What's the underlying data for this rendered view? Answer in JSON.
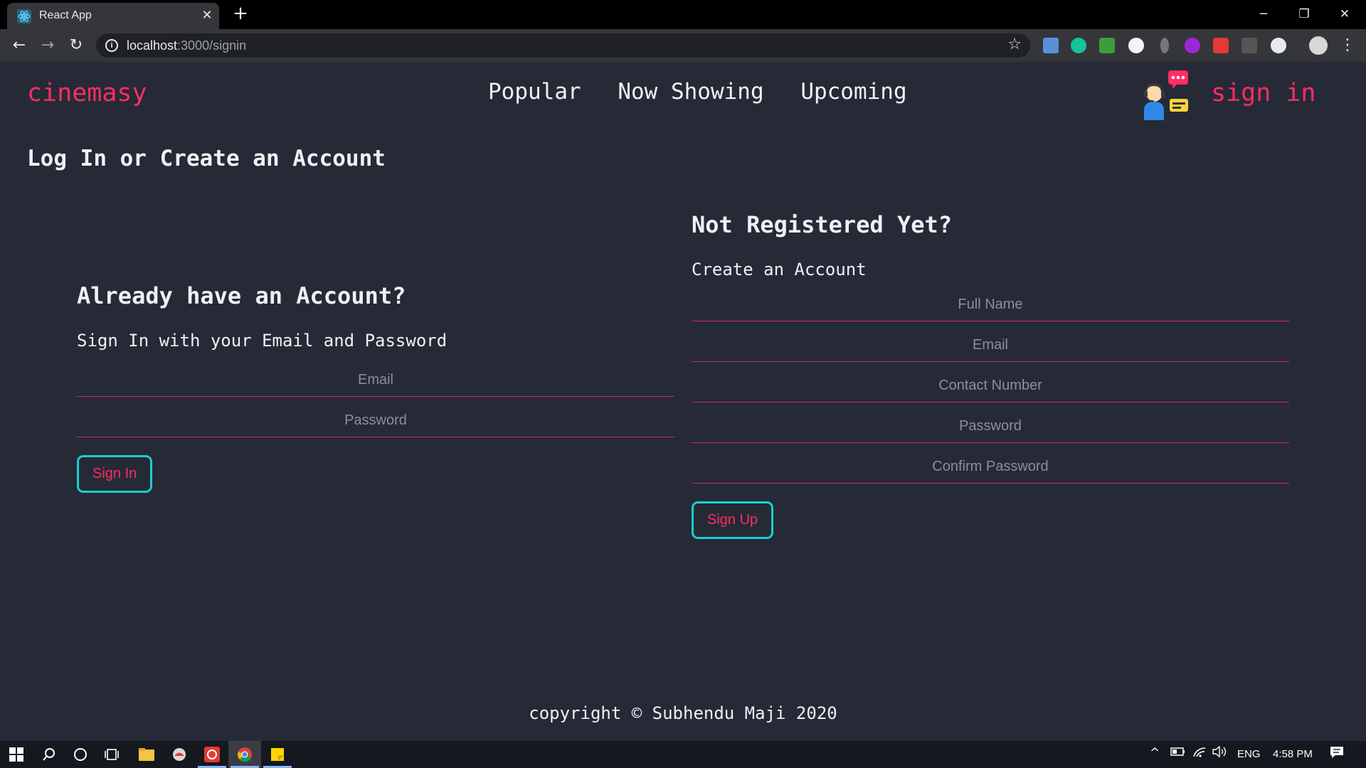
{
  "browser": {
    "tab_title": "React App",
    "url_host": "localhost",
    "url_path": ":3000/signin",
    "icons": {
      "tab_close": "✕",
      "new_tab": "+",
      "minimize": "─",
      "restore": "❐",
      "close": "✕",
      "back": "←",
      "forward": "→",
      "reload": "↻",
      "info": "i",
      "star": "☆",
      "menu": "⋮"
    }
  },
  "header": {
    "brand": "cinemasy",
    "nav": [
      {
        "label": "Popular"
      },
      {
        "label": "Now Showing"
      },
      {
        "label": "Upcoming"
      }
    ],
    "signin_label": "sign in",
    "icon": "customer-support-icon"
  },
  "page": {
    "heading": "Log In or Create an Account"
  },
  "login": {
    "heading": "Already have an Account?",
    "subheading": "Sign In with your Email and Password",
    "email_placeholder": "Email",
    "password_placeholder": "Password",
    "submit_label": "Sign In"
  },
  "register": {
    "heading": "Not Registered Yet?",
    "subheading": "Create an Account",
    "fullname_placeholder": "Full Name",
    "email_placeholder": "Email",
    "contact_placeholder": "Contact Number",
    "password_placeholder": "Password",
    "confirm_placeholder": "Confirm Password",
    "submit_label": "Sign Up"
  },
  "footer": {
    "copyright": "copyright © Subhendu Maji 2020"
  },
  "taskbar": {
    "language": "ENG",
    "time": "4:58 PM"
  },
  "colors": {
    "accent_pink": "#ff2d63",
    "accent_cyan": "#19cfd1",
    "background": "#252a36"
  }
}
